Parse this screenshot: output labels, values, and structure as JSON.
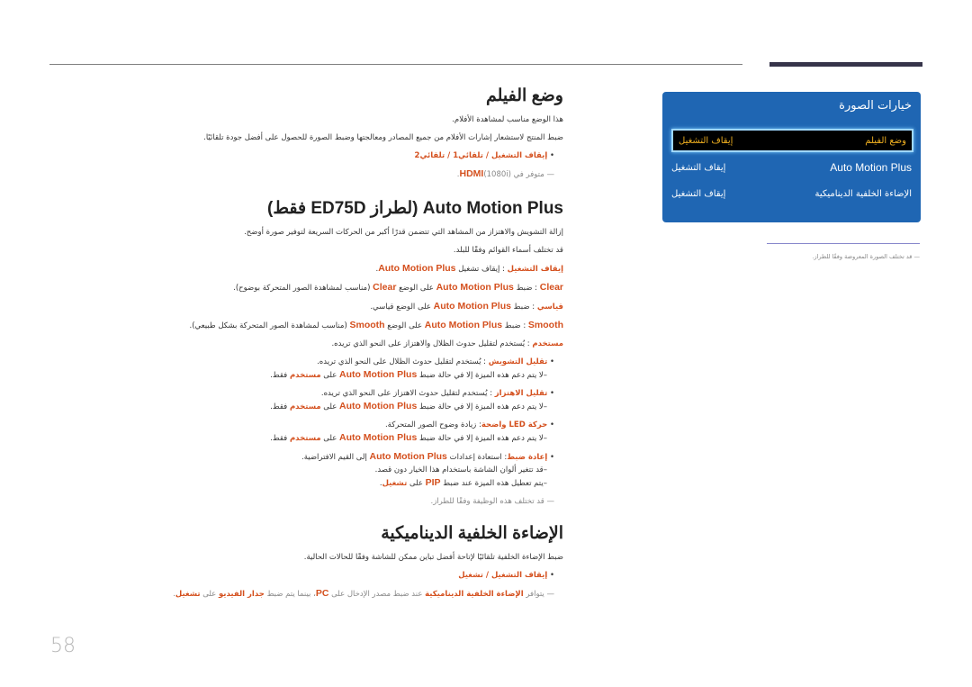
{
  "page_number": "58",
  "panel": {
    "title": "خيارات الصورة",
    "rows": [
      {
        "label": "وضع الفيلم",
        "value": "إيقاف التشغيل",
        "selected": true
      },
      {
        "label": "Auto Motion Plus",
        "value": "إيقاف التشغيل",
        "selected": false
      },
      {
        "label": "الإضاءة الخلفية الديناميكية",
        "value": "إيقاف التشغيل",
        "selected": false
      }
    ],
    "note": "قد تختلف الصورة المعروضة وفقًا للطراز."
  },
  "film_mode": {
    "title": "وضع الفيلم",
    "desc1": "هذا الوضع مناسب لمشاهدة الأفلام.",
    "desc2": "ضبط المنتج لاستشعار إشارات الأفلام من جميع المصادر ومعالجتها وضبط الصورة للحصول على أفضل جودة تلقائيًا.",
    "options": [
      "إيقاف التشغيل",
      "تلقائي1",
      "تلقائي2"
    ],
    "note_prefix": "متوفر في",
    "note_hdmi": "HDMI",
    "note_suffix": "(1080i)."
  },
  "amp": {
    "title": "Auto Motion Plus (لطراز ED75D فقط)",
    "desc1": "إزالة التشويش والاهتزاز من المشاهد التي تتضمن قدرًا أكبر من الحركات السريعة لتوفير صورة أوضح.",
    "desc2": "قد تختلف أسماء القوائم وفقًا للبلد.",
    "off_label": "إيقاف التشغيل",
    "off_text": " : إيقاف تشغيل ",
    "brand": "Auto Motion Plus",
    "clear_label": "Clear",
    "clear_text1": " : ضبط ",
    "clear_text2": " على الوضع ",
    "clear_text3": " (مناسب لمشاهدة الصور المتحركة بوضوح).",
    "std_label": "قياسي",
    "std_text1": " : ضبط ",
    "std_text2": " على الوضع قياسي.",
    "smooth_label": "Smooth",
    "smooth_text3": " (مناسب لمشاهدة الصور المتحركة بشكل طبيعي).",
    "custom_label": "مستخدم",
    "custom_text": " : يُستخدم لتقليل حدوث الظلال والاهتزاز على النحو الذي تريده.",
    "blur_label": "تقليل التشويش",
    "blur_text": " : يُستخدم لتقليل حدوث الظلال على النحو الذي تريده.",
    "judder_label": "تقليل الاهتزاز",
    "judder_text": " : يُستخدم لتقليل حدوث الاهتزاز على النحو الذي تريده.",
    "led_label": "حركة LED واضحة",
    "led_text": ": زيادة وضوح الصور المتحركة.",
    "support_text1": "–لا يتم دعم هذه الميزة إلا في حالة ضبط ",
    "support_text2": " على ",
    "support_text3": " فقط.",
    "reset_label": "إعادة ضبط",
    "reset_text1": ": استعادة إعدادات ",
    "reset_text2": " إلى القيم الافتراضية.",
    "reset_note1": "–قد تتغير ألوان الشاشة باستخدام هذا الخيار دون قصد.",
    "reset_note2a": "–يتم تعطيل هذه الميزة عند ضبط ",
    "pip": "PIP",
    "reset_note2b": " على ",
    "on_label": "تشغيل",
    "final_note": "قد تختلف هذه الوظيفة وفقًا للطراز."
  },
  "dyn": {
    "title": "الإضاءة الخلفية الديناميكية",
    "desc": "ضبط الإضاءة الخلفية تلقائيًا لإتاحة أفضل تباين ممكن للشاشة وفقًا للحالات الحالية.",
    "options": [
      "إيقاف التشغيل",
      "تشغيل"
    ],
    "note1": "يتوافر ",
    "note_feature": "الإضاءة الخلفية الديناميكية",
    "note2": " عند ضبط مصدر الإدخال على ",
    "pc": "PC",
    "note3": "، بينما يتم ضبط ",
    "video_wall": "جدار الفيديو",
    "note4": " على ",
    "on": "تشغيل"
  }
}
